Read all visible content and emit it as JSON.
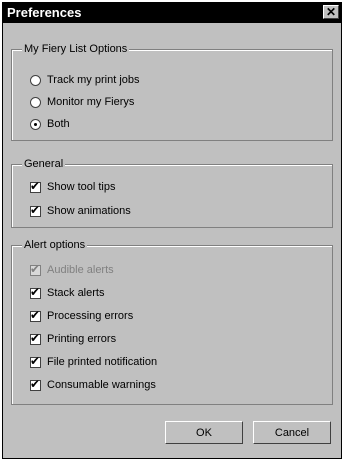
{
  "window": {
    "title": "Preferences",
    "close_label": "✕"
  },
  "groups": {
    "list_options": {
      "legend": "My Fiery List Options",
      "radios": [
        {
          "label": "Track my print jobs",
          "selected": false
        },
        {
          "label": "Monitor my Fierys",
          "selected": false
        },
        {
          "label": "Both",
          "selected": true
        }
      ]
    },
    "general": {
      "legend": "General",
      "checks": [
        {
          "label": "Show tool tips",
          "checked": true
        },
        {
          "label": "Show animations",
          "checked": true
        }
      ]
    },
    "alerts": {
      "legend": "Alert options",
      "checks": [
        {
          "label": "Audible alerts",
          "checked": true,
          "disabled": true
        },
        {
          "label": "Stack alerts",
          "checked": true
        },
        {
          "label": "Processing errors",
          "checked": true
        },
        {
          "label": "Printing errors",
          "checked": true
        },
        {
          "label": "File printed notification",
          "checked": true
        },
        {
          "label": "Consumable warnings",
          "checked": true
        }
      ]
    }
  },
  "buttons": {
    "ok": "OK",
    "cancel": "Cancel"
  }
}
